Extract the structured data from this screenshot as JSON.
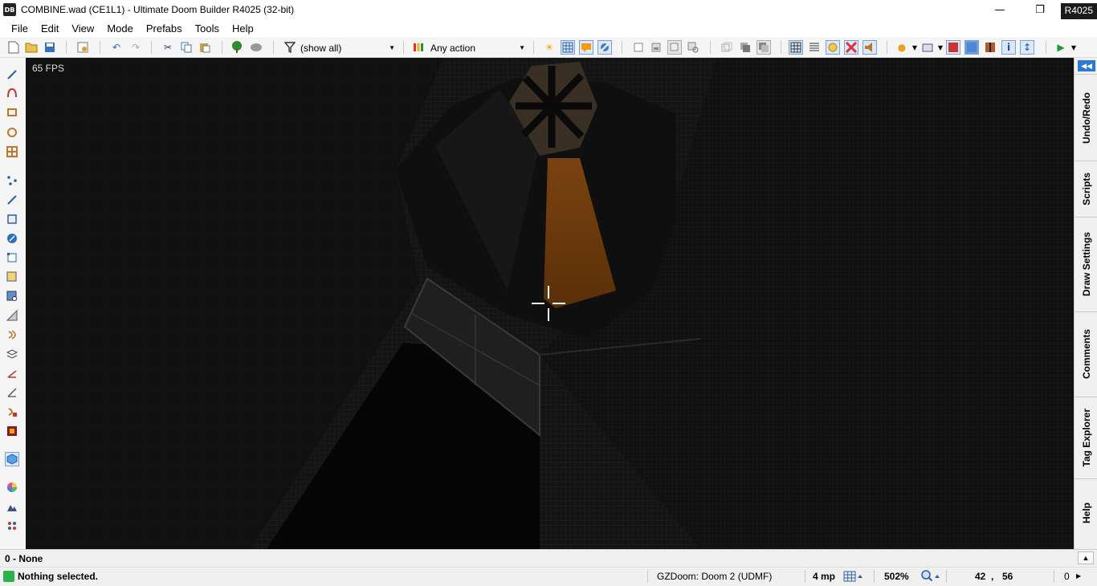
{
  "window": {
    "app_icon_text": "DB",
    "title": "COMBINE.wad (CE1L1) - Ultimate Doom Builder R4025 (32-bit)",
    "minimize_label": "—",
    "restore_label": "❐",
    "revision_badge": "R4025"
  },
  "menu": [
    "File",
    "Edit",
    "View",
    "Mode",
    "Prefabs",
    "Tools",
    "Help"
  ],
  "toolbar": {
    "filter_value": "(show all)",
    "action_value": "Any action",
    "icons": [
      "new-map",
      "open-map",
      "save-map",
      "map-options",
      "undo",
      "redo",
      "cut",
      "copy",
      "paste",
      "tree-things",
      "thing-filter-gray",
      "filter",
      "action-markers",
      "brightness",
      "grid",
      "comments",
      "fullbright",
      "new-item",
      "insert-prefab",
      "prefab-gray",
      "copy-props",
      "paste-props",
      "paste-special",
      "texture-grid",
      "texture-list",
      "light-bulb",
      "model-box",
      "sky-fog",
      "sky",
      "dynamic-light",
      "info",
      "up-down",
      "test-map"
    ]
  },
  "left_tools": [
    "draw-lines",
    "draw-curve",
    "draw-rectangle",
    "draw-ellipse",
    "draw-grid",
    "vertices-mode",
    "linedefs-mode",
    "sectors-mode",
    "things-mode",
    "make-sectors",
    "edit-selection",
    "visual-mode",
    "brightness-mode",
    "sound-propagation",
    "3d-floors",
    "slope-lines",
    "linedef-edit",
    "sound-environment",
    "auto-map",
    "visual-mode-active",
    "color-picker",
    "terrain",
    "paint-selection"
  ],
  "viewport": {
    "fps": "65 FPS"
  },
  "right_tabs": [
    "Undo/Redo",
    "Scripts",
    "Draw Settings",
    "Comments",
    "Tag Explorer",
    "Help"
  ],
  "info": {
    "label": "0 - None",
    "expand": "▲"
  },
  "status": {
    "message": "Nothing selected.",
    "engine": "GZDoom: Doom 2 (UDMF)",
    "grid": "4 mp",
    "zoom": "502%",
    "coord_x": "42",
    "coord_sep": ",",
    "coord_y": "56",
    "last": "0"
  }
}
